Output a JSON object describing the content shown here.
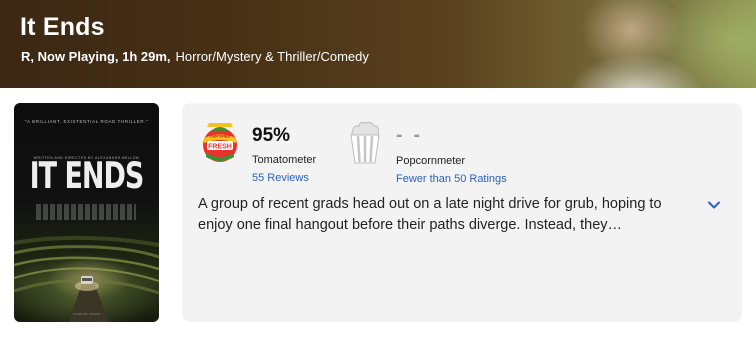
{
  "header": {
    "title": "It Ends",
    "meta_strong": "R, Now Playing, 1h 29m,",
    "genres": "Horror/Mystery & Thriller/Comedy"
  },
  "poster": {
    "quote": "\"A BRILLIANT, EXISTENTIAL ROAD THRILLER.\"",
    "title": "IT ENDS",
    "credit": "WRITTEN AND DIRECTED BY ALEXANDER BELLOM",
    "footer": "COMING SOON"
  },
  "tomatometer": {
    "value": "95%",
    "label": "Tomatometer",
    "link": "55 Reviews",
    "icon": "certified-fresh-icon",
    "badge_text": "FRESH",
    "badge_top": "CERTIFIED",
    "colors": {
      "red": "#e8332c",
      "yellow": "#f6c21b",
      "green": "#3e8e35"
    }
  },
  "popcornmeter": {
    "value": "- -",
    "label": "Popcornmeter",
    "link": "Fewer than 50 Ratings",
    "icon": "popcorn-empty-icon"
  },
  "synopsis": {
    "text": "A group of recent grads head out on a late night drive for grub, hoping to enjoy one final hangout before their paths diverge. Instead, they…",
    "expand_icon": "chevron-down-icon"
  },
  "colors": {
    "link": "#2a62c9",
    "card_bg": "#f3f3f3"
  }
}
